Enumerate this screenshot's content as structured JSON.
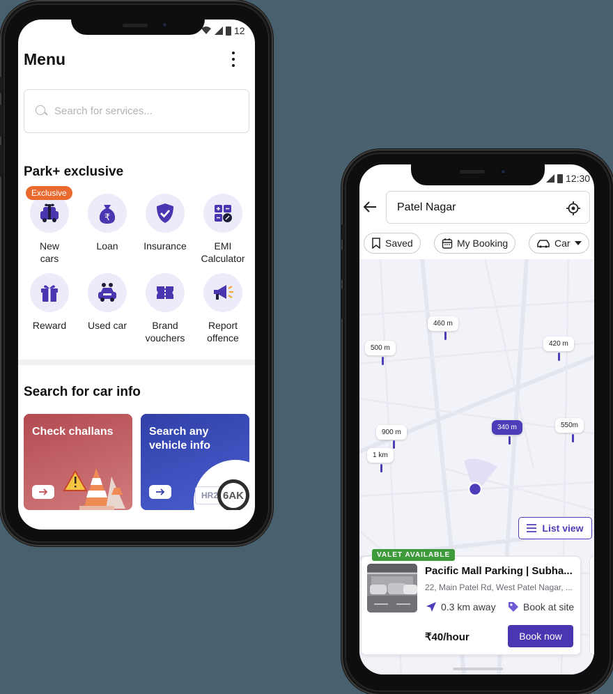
{
  "left_phone": {
    "status_time": "12",
    "menu_title": "Menu",
    "search_placeholder": "Search for services...",
    "exclusive_section_title": "Park+ exclusive",
    "exclusive_badge": "Exclusive",
    "services": [
      {
        "line1": "New",
        "line2": "cars",
        "icon": "car-gift-icon"
      },
      {
        "line1": "Loan",
        "line2": "",
        "icon": "money-bag-rupee-icon"
      },
      {
        "line1": "Insurance",
        "line2": "",
        "icon": "shield-check-icon"
      },
      {
        "line1": "EMI",
        "line2": "Calculator",
        "icon": "calculator-icon"
      },
      {
        "line1": "Reward",
        "line2": "",
        "icon": "gift-icon"
      },
      {
        "line1": "Used car",
        "line2": "",
        "icon": "used-car-icon"
      },
      {
        "line1": "Brand",
        "line2": "vouchers",
        "icon": "voucher-ticket-icon"
      },
      {
        "line1": "Report",
        "line2": "offence",
        "icon": "megaphone-icon"
      }
    ],
    "car_info_section_title": "Search for car info",
    "cards": [
      {
        "title": "Check challans",
        "color": "#c85a5f",
        "icon": "warning-cone-icon"
      },
      {
        "title": "Search any vehicle info",
        "color": "#3b4bb8",
        "plate_text": "HR2",
        "plate_zoom": "6AK"
      }
    ]
  },
  "right_phone": {
    "status_time": "12:30",
    "location": "Patel Nagar",
    "chips": [
      {
        "label": "Saved",
        "icon": "bookmark-icon"
      },
      {
        "label": "My Booking",
        "icon": "calendar-icon"
      },
      {
        "label": "Car",
        "icon": "car-icon"
      }
    ],
    "distance_markers": [
      "460 m",
      "500 m",
      "420 m",
      "900 m",
      "340 m",
      "550m",
      "1 km"
    ],
    "selected_marker": "340 m",
    "list_view_label": "List view",
    "parking": {
      "badge": "VALET AVAILABLE",
      "name": "Pacific Mall Parking | Subha...",
      "address": "22, Main Patel Rd, West Patel Nagar, ...",
      "distance": "0.3 km away",
      "booking_type": "Book at site",
      "price": "₹40/hour",
      "book_label": "Book now"
    },
    "colors": {
      "accent": "#4a36b1",
      "valet": "#3e9a3a"
    }
  }
}
